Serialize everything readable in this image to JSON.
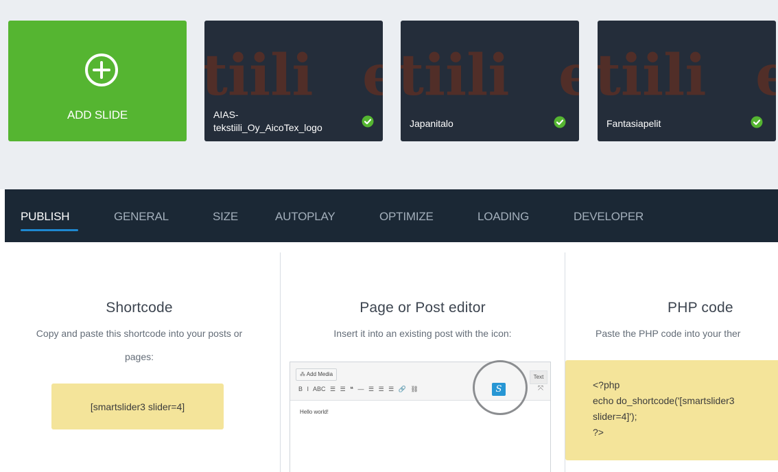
{
  "slides": {
    "add_label": "ADD SLIDE",
    "items": [
      {
        "title": "AIAS-tekstiili_Oy_AicoTex_logo",
        "title_line1": "AIAS-",
        "title_line2": "tekstiili_Oy_AicoTex_logo",
        "status": "published"
      },
      {
        "title": "Japanitalo",
        "status": "published"
      },
      {
        "title": "Fantasiapelit",
        "status": "published"
      }
    ],
    "thumbnail_text": "tiili",
    "colors": {
      "add_bg": "#55b531",
      "card_bg": "#242d3a",
      "thumb_text": "#5a2f26",
      "check": "#55b531"
    }
  },
  "tabs": {
    "items": [
      "PUBLISH",
      "GENERAL",
      "SIZE",
      "AUTOPLAY",
      "OPTIMIZE",
      "LOADING",
      "DEVELOPER"
    ],
    "active": "PUBLISH"
  },
  "shortcode": {
    "title": "Shortcode",
    "desc_line1": "Copy and paste this shortcode into your posts or",
    "desc_line2": "pages:",
    "code": "[smartslider3 slider=4]"
  },
  "editor_col": {
    "title": "Page or Post editor",
    "desc": "Insert it into an existing post with the icon:",
    "add_media": "Add Media",
    "tab_text": "Text",
    "body_text": "Hello world!",
    "toolbar_icons": "B I ABC ☰ ☰ ❝ — ☰ ☰ ☰ 🔗 ⛓",
    "s_icon": "S"
  },
  "php": {
    "title": "PHP code",
    "desc": "Paste the PHP code into your ther",
    "line1": "<?php",
    "line2": "echo do_shortcode('[smartslider3",
    "line3": "slider=4]');",
    "line4": "?>"
  }
}
